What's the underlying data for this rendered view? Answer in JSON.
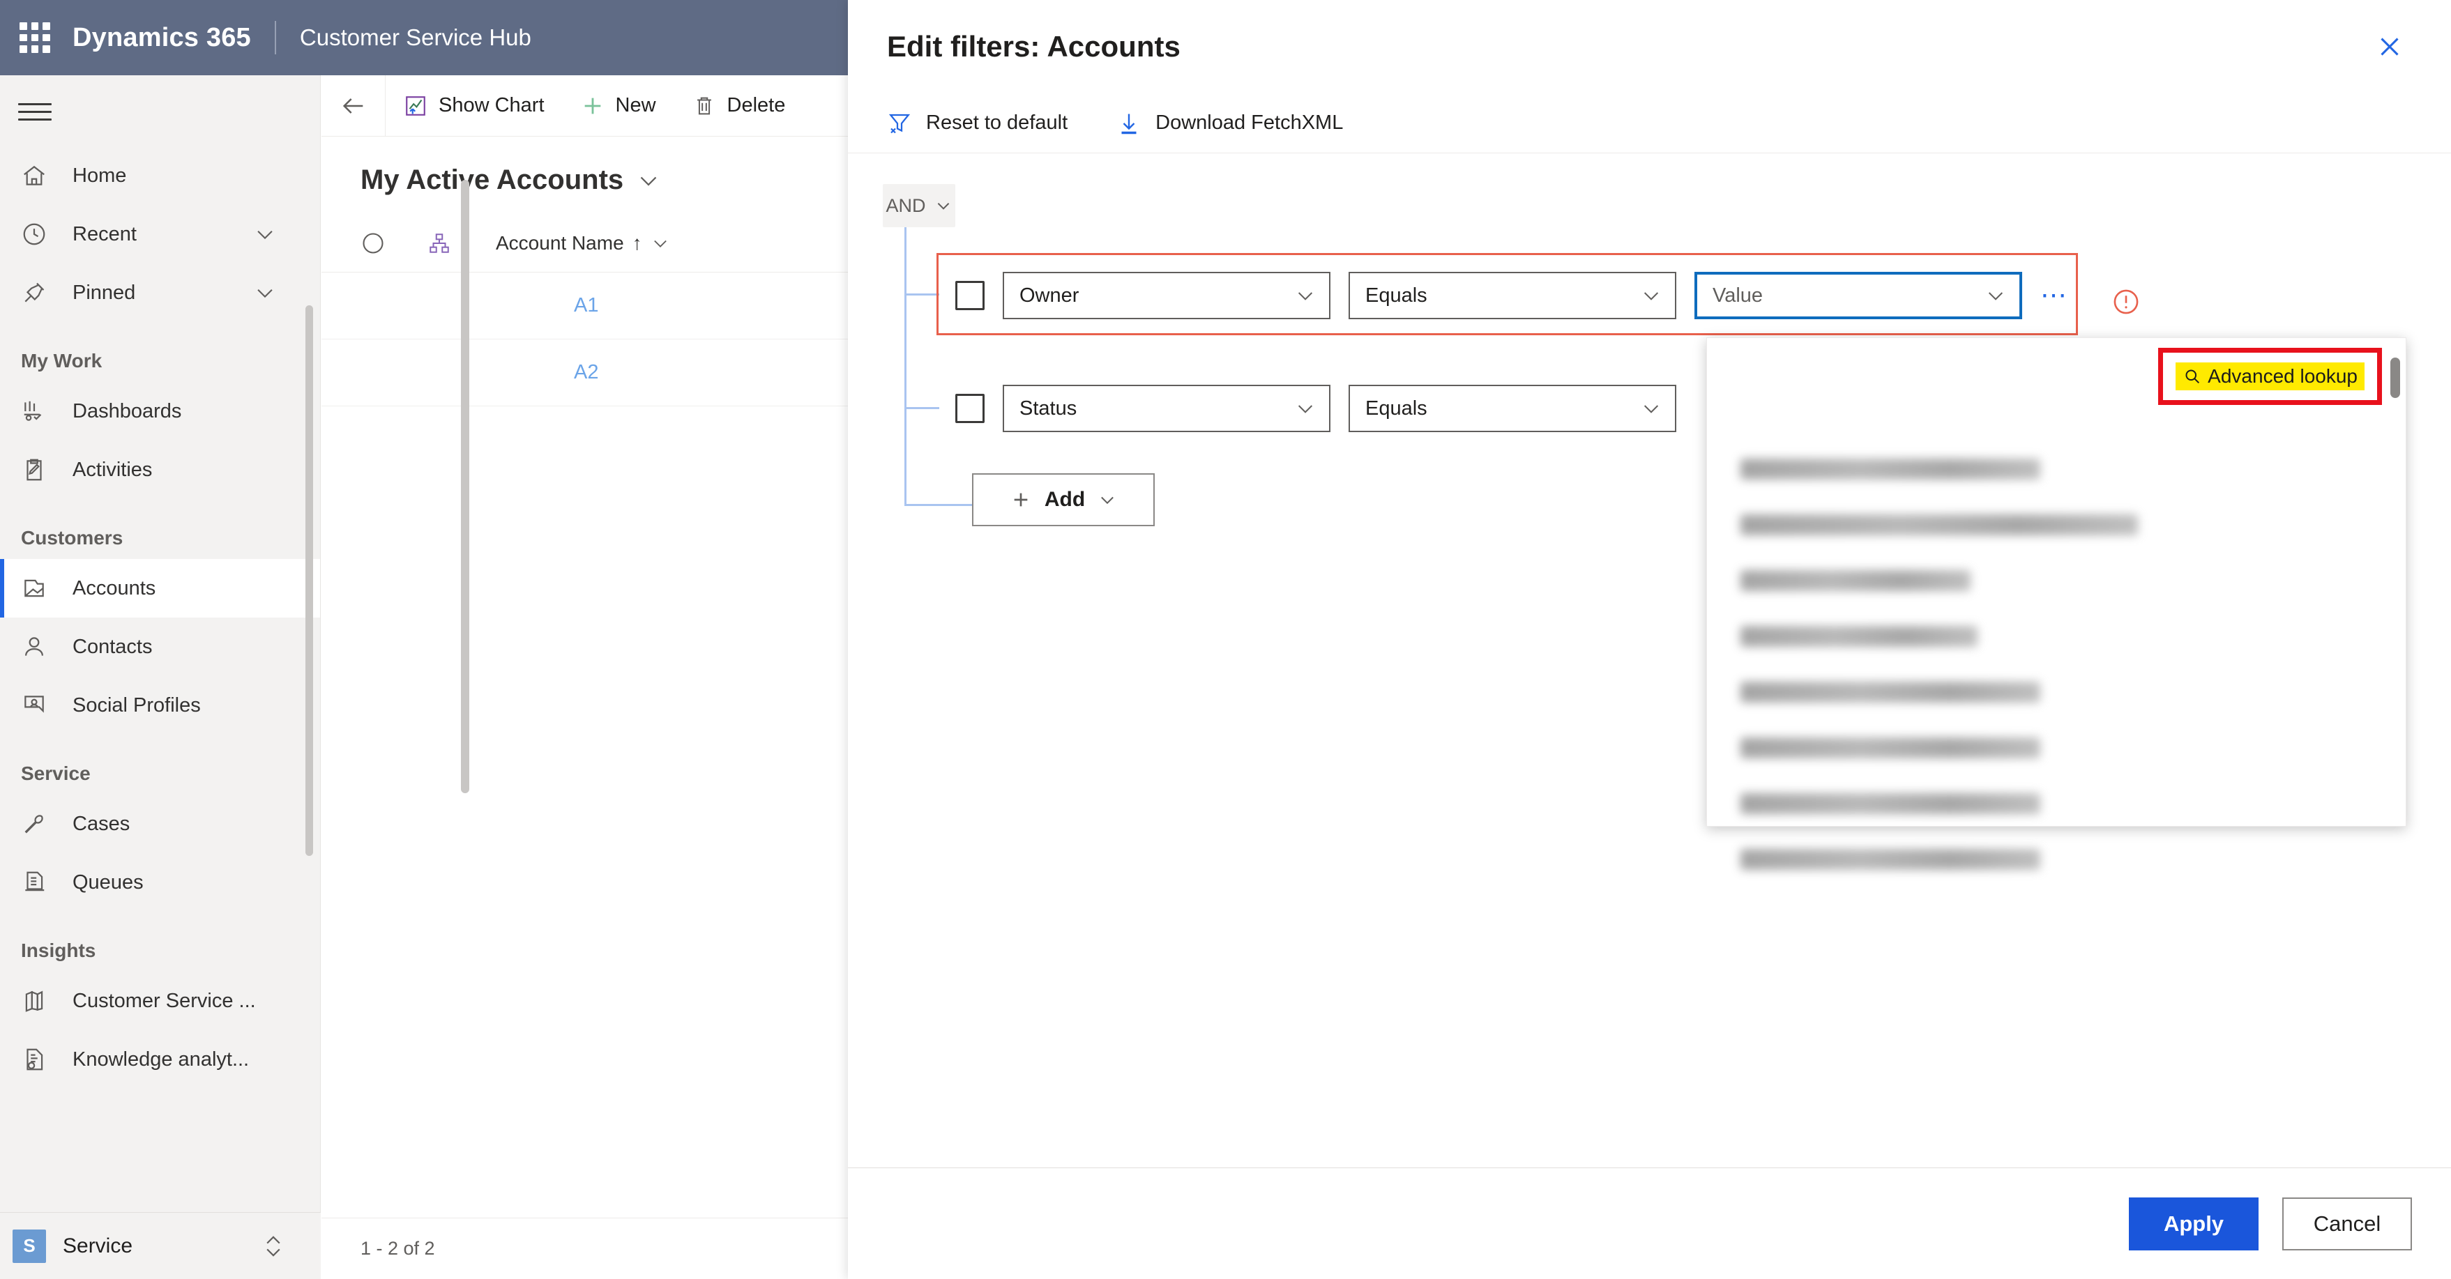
{
  "topnav": {
    "waffle_icon": "waffle-grid-icon",
    "brand": "Dynamics 365",
    "app_name": "Customer Service Hub"
  },
  "sidebar": {
    "hamburger_icon": "hamburger-menu-icon",
    "items": [
      {
        "label": "Home",
        "icon": "home-icon",
        "type": "item",
        "expandable": false,
        "active": false
      },
      {
        "label": "Recent",
        "icon": "clock-icon",
        "type": "item",
        "expandable": true,
        "active": false
      },
      {
        "label": "Pinned",
        "icon": "pin-icon",
        "type": "item",
        "expandable": true,
        "active": false
      },
      {
        "label": "My Work",
        "type": "group"
      },
      {
        "label": "Dashboards",
        "icon": "dashboard-icon",
        "type": "item",
        "expandable": false,
        "active": false
      },
      {
        "label": "Activities",
        "icon": "activities-icon",
        "type": "item",
        "expandable": false,
        "active": false
      },
      {
        "label": "Customers",
        "type": "group"
      },
      {
        "label": "Accounts",
        "icon": "accounts-icon",
        "type": "item",
        "expandable": false,
        "active": true
      },
      {
        "label": "Contacts",
        "icon": "contact-person-icon",
        "type": "item",
        "expandable": false,
        "active": false
      },
      {
        "label": "Social Profiles",
        "icon": "social-profile-icon",
        "type": "item",
        "expandable": false,
        "active": false
      },
      {
        "label": "Service",
        "type": "group"
      },
      {
        "label": "Cases",
        "icon": "wrench-icon",
        "type": "item",
        "expandable": false,
        "active": false
      },
      {
        "label": "Queues",
        "icon": "queue-icon",
        "type": "item",
        "expandable": false,
        "active": false
      },
      {
        "label": "Insights",
        "type": "group"
      },
      {
        "label": "Customer Service ...",
        "icon": "bar-chart-icon",
        "type": "item",
        "expandable": false,
        "active": false
      },
      {
        "label": "Knowledge analyt...",
        "icon": "knowledge-doc-icon",
        "type": "item",
        "expandable": false,
        "active": false
      }
    ],
    "footer": {
      "badge": "S",
      "label": "Service",
      "icon": "up-down-chevron-icon"
    }
  },
  "main": {
    "commands": [
      {
        "label": "Show Chart",
        "icon": "show-chart-icon"
      },
      {
        "label": "New",
        "icon": "plus-icon"
      },
      {
        "label": "Delete",
        "icon": "trash-icon"
      }
    ],
    "back_icon": "back-arrow-icon",
    "view_title": "My Active Accounts",
    "view_chevron_icon": "chevron-down-icon",
    "grid": {
      "select_all_icon": "select-all-circle-icon",
      "hierarchy_icon": "hierarchy-icon",
      "columns": [
        "Account Name"
      ],
      "sort_indicator": "↑",
      "column_menu_icon": "chevron-down-icon",
      "rows": [
        "A1",
        "A2"
      ]
    },
    "record_count": "1 - 2 of 2"
  },
  "panel": {
    "title": "Edit filters: Accounts",
    "close_icon": "close-x-icon",
    "tools": [
      {
        "label": "Reset to default",
        "icon": "reset-filter-icon"
      },
      {
        "label": "Download FetchXML",
        "icon": "download-arrow-icon"
      }
    ],
    "group_operator": {
      "label": "AND",
      "icon": "chevron-down-icon"
    },
    "rows": [
      {
        "checkbox_checked": false,
        "field": "Owner",
        "operator": "Equals",
        "value_placeholder": "Value",
        "value_focused": true,
        "has_error": true,
        "more_icon": "ellipsis-icon",
        "error_icon": "error-circle-icon"
      },
      {
        "checkbox_checked": false,
        "field": "Status",
        "operator": "Equals",
        "value_placeholder": "",
        "value_focused": false,
        "has_error": false
      }
    ],
    "add_button": {
      "label": "Add",
      "plus_icon": "plus-icon",
      "chevron_icon": "chevron-down-icon"
    },
    "dropdown": {
      "advanced_lookup": {
        "label": "Advanced lookup",
        "icon": "search-icon"
      },
      "highlight_color": "#ffea00",
      "annotation_color": "#e8111c",
      "scrollbar_icon": "scrollbar-thumb",
      "items_redacted_widths": [
        430,
        570,
        330,
        340,
        430,
        430,
        430,
        430
      ],
      "item_count": 8
    },
    "footer": {
      "apply_label": "Apply",
      "cancel_label": "Cancel",
      "apply_color": "#1a56db"
    }
  }
}
